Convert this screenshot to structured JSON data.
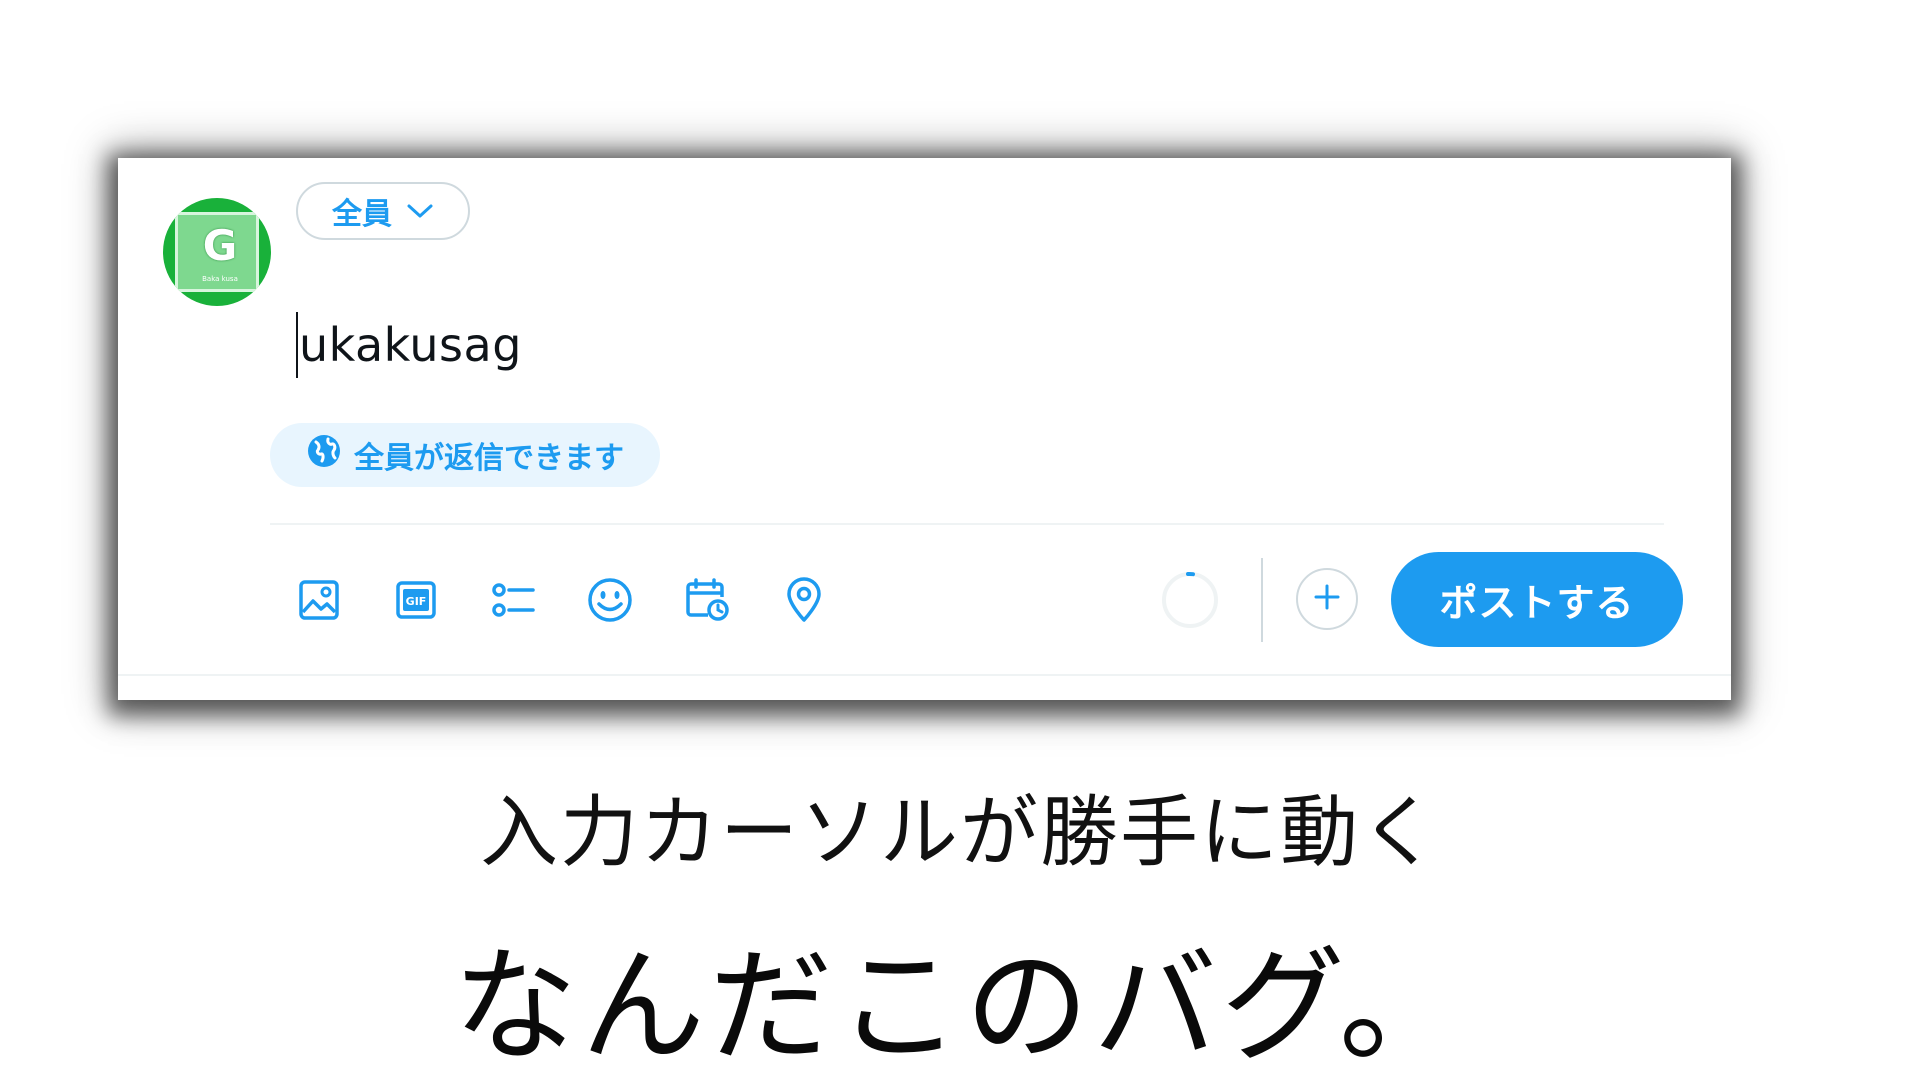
{
  "composer": {
    "avatar": {
      "letter": "G",
      "small_text": "Baka kusa"
    },
    "audience_label": "全員",
    "editor_text": "ukakusag",
    "reply_setting_label": "全員が返信できます",
    "toolbar_icons": [
      "image-icon",
      "gif-icon",
      "poll-icon",
      "emoji-icon",
      "schedule-icon",
      "location-icon"
    ],
    "post_button_label": "ポストする",
    "accent_color": "#1d9bf0"
  },
  "captions": {
    "line1": "入力カーソルが勝手に動く",
    "line2": "なんだこのバグ。"
  }
}
